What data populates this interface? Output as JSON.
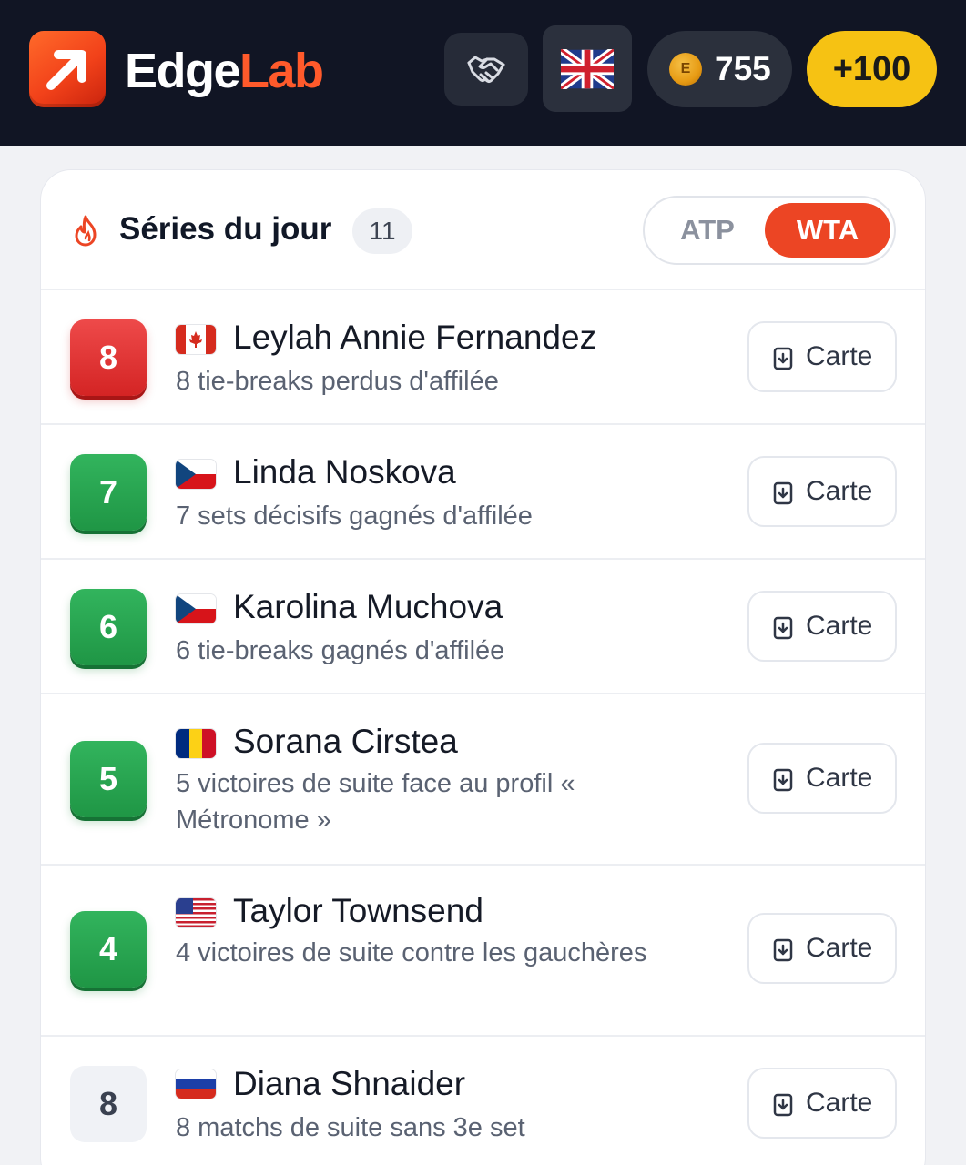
{
  "header": {
    "brand_part1": "Edge",
    "brand_part2": "Lab",
    "partners_icon": "handshake-icon",
    "language_flag": "uk-flag",
    "coins": "755",
    "bonus_label": "+100",
    "colors": {
      "brand_accent": "#ff5a2b",
      "bonus_yellow": "#f6c213",
      "header_bg": "#111524"
    }
  },
  "streaks": {
    "title": "Séries du jour",
    "count": "11",
    "tabs": [
      {
        "label": "ATP",
        "active": false
      },
      {
        "label": "WTA",
        "active": true
      }
    ],
    "items": [
      {
        "rank": "8",
        "color": "red",
        "flag": "canada",
        "name": "Leylah Annie Fernandez",
        "description": "8 tie-breaks perdus d'affilée",
        "action": "Carte"
      },
      {
        "rank": "7",
        "color": "green",
        "flag": "czech-republic",
        "name": "Linda Noskova",
        "description": "7 sets décisifs gagnés d'affilée",
        "action": "Carte"
      },
      {
        "rank": "6",
        "color": "green",
        "flag": "czech-republic",
        "name": "Karolina Muchova",
        "description": "6 tie-breaks gagnés d'affilée",
        "action": "Carte"
      },
      {
        "rank": "5",
        "color": "green",
        "flag": "romania",
        "name": "Sorana Cirstea",
        "description": "5 victoires de suite face au profil « Métronome »",
        "action": "Carte"
      },
      {
        "rank": "4",
        "color": "green",
        "flag": "usa",
        "name": "Taylor Townsend",
        "description": "4 victoires de suite contre les gauchères",
        "action": "Carte"
      },
      {
        "rank": "8",
        "color": "gray",
        "flag": "russia",
        "name": "Diana Shnaider",
        "description": "8 matchs de suite sans 3e set",
        "action": "Carte"
      }
    ]
  }
}
